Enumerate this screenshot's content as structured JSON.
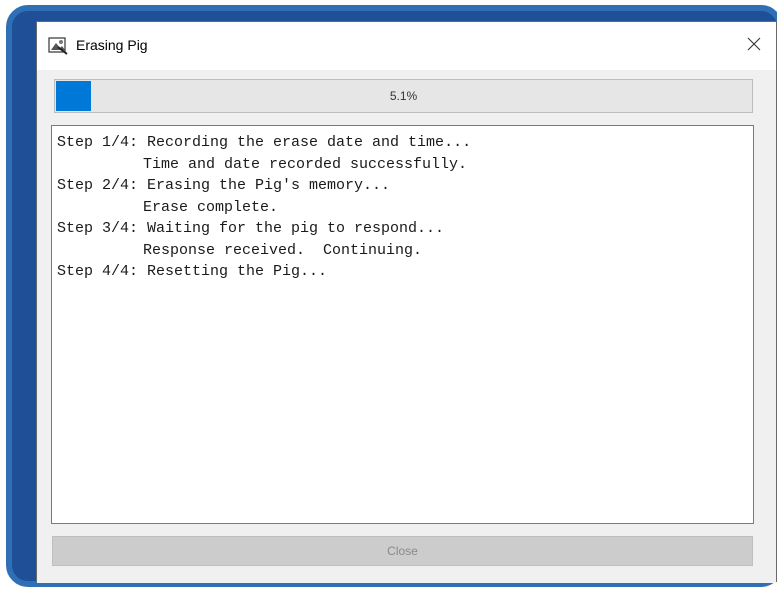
{
  "window": {
    "title": "Erasing Pig",
    "icon": "erase-pig-app-icon",
    "close_icon": "close-icon"
  },
  "progress": {
    "value": 0.051,
    "label": "5.1%",
    "fill_color": "#0078d7"
  },
  "log": {
    "lines": [
      {
        "text": "Step 1/4: Recording the erase date and time...",
        "indent": false
      },
      {
        "text": "Time and date recorded successfully.",
        "indent": true
      },
      {
        "text": "Step 2/4: Erasing the Pig's memory...",
        "indent": false
      },
      {
        "text": "Erase complete.",
        "indent": true
      },
      {
        "text": "Step 3/4: Waiting for the pig to respond...",
        "indent": false
      },
      {
        "text": "Response received.  Continuing.",
        "indent": true
      },
      {
        "text": "Step 4/4: Resetting the Pig...",
        "indent": false
      }
    ]
  },
  "footer": {
    "close_label": "Close",
    "close_enabled": false
  },
  "colors": {
    "frame": "#2f6fb6",
    "accent": "#0078d7"
  }
}
